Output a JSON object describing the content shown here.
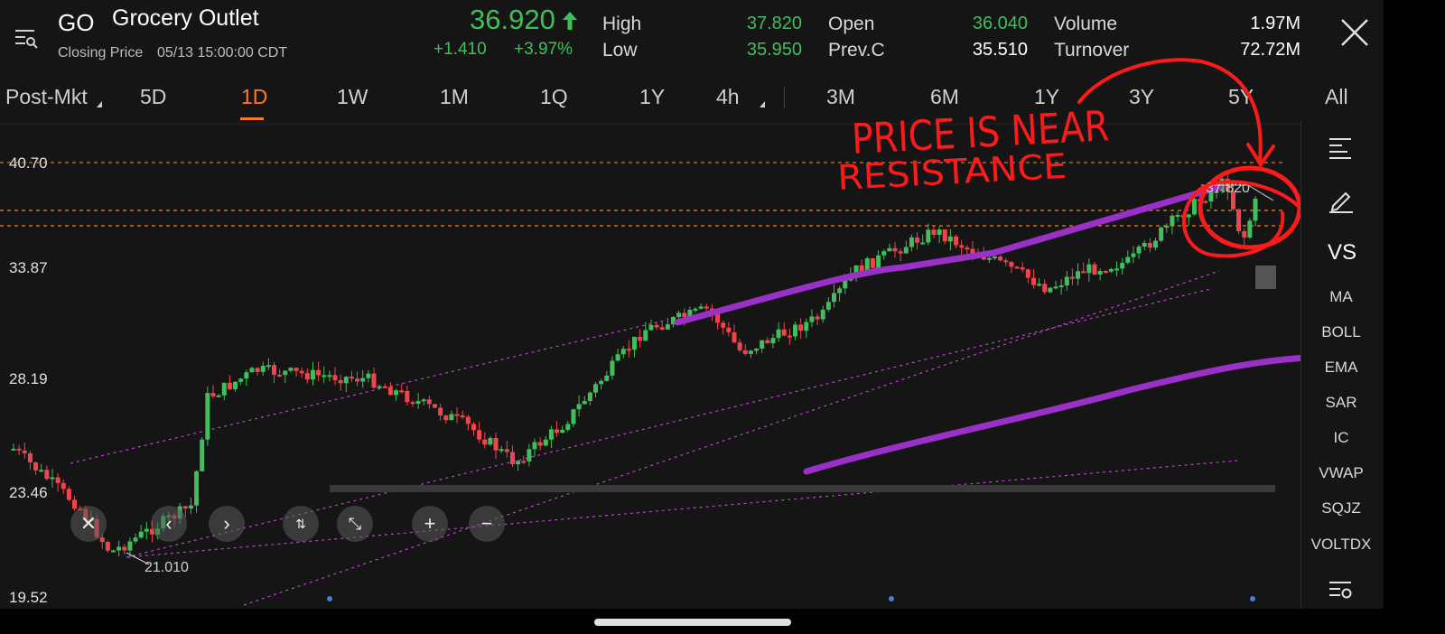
{
  "header": {
    "ticker": "GO",
    "company": "Grocery Outlet",
    "closing_label": "Closing Price",
    "closing_time": "05/13 15:00:00 CDT",
    "price": "36.920",
    "price_arrow_icon": "up-arrow-icon",
    "change": "+1.410",
    "change_pct": "+3.97%",
    "high_label": "High",
    "high": "37.820",
    "low_label": "Low",
    "low": "35.950",
    "open_label": "Open",
    "open": "36.040",
    "prevc_label": "Prev.C",
    "prevc": "35.510",
    "volume_label": "Volume",
    "volume": "1.97M",
    "turnover_label": "Turnover",
    "turnover": "72.72M"
  },
  "timeframes": [
    "Post-Mkt",
    "5D",
    "1D",
    "1W",
    "1M",
    "1Q",
    "1Y",
    "4h",
    "3M",
    "6M",
    "1Y",
    "3Y",
    "5Y",
    "All"
  ],
  "active_timeframe": "1D",
  "yaxis": [
    "40.70",
    "33.87",
    "28.19",
    "23.46",
    "19.52"
  ],
  "annotations": {
    "high_marker": "37.820",
    "low_marker": "21.010",
    "handwritten": "PRICE IS NEAR RESISTANCE"
  },
  "sidebar": {
    "vs_label": "VS",
    "indicators": [
      "MA",
      "BOLL",
      "EMA",
      "SAR",
      "IC",
      "VWAP",
      "SQJZ",
      "VOLTDX"
    ],
    "active_indicator": "VOLTDX"
  },
  "colors": {
    "up": "#3fbf5a",
    "down": "#f0454e",
    "accent": "#ff7a1a",
    "drawing": "#9b30c8",
    "pen": "#ff1a1a"
  }
}
